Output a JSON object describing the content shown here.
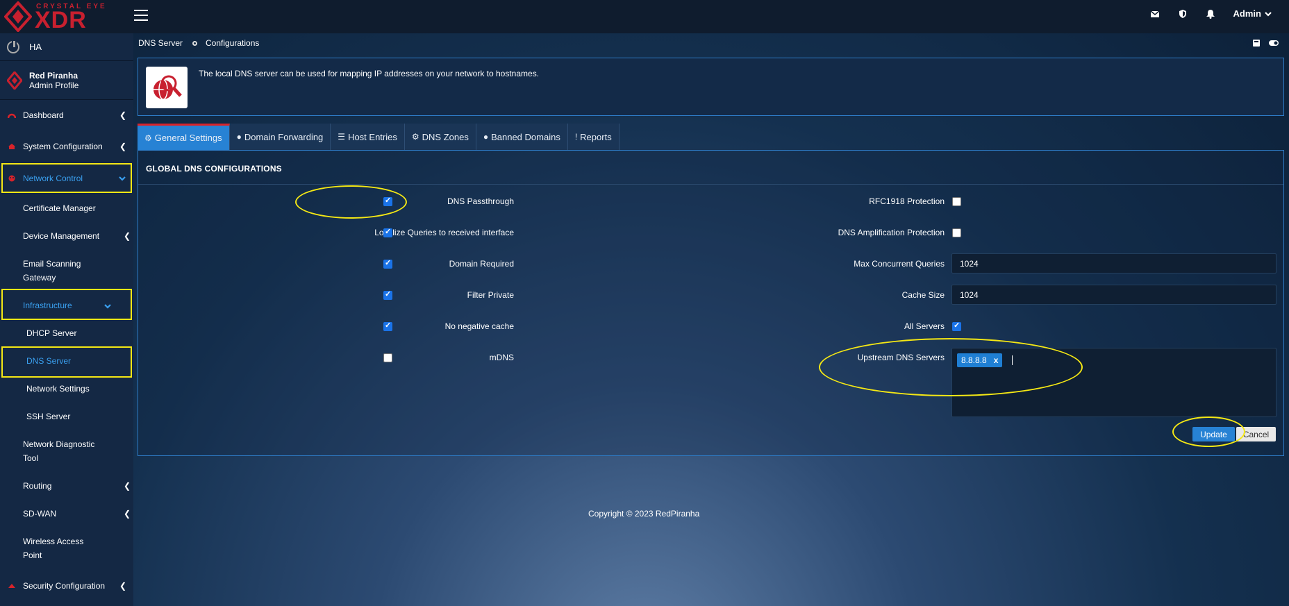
{
  "topbar": {
    "brand_small": "CRYSTAL EYE",
    "brand_big": "XDR",
    "admin_label": "Admin"
  },
  "sidebar": {
    "ha_label": "HA",
    "profile_name": "Red Piranha",
    "profile_role": "Admin Profile",
    "items": [
      {
        "label": "Dashboard"
      },
      {
        "label": "System Configuration"
      },
      {
        "label": "Network Control"
      },
      {
        "label": "Certificate Manager"
      },
      {
        "label": "Device Management"
      },
      {
        "label": "Email Scanning",
        "label2": "Gateway"
      },
      {
        "label": "Infrastructure"
      },
      {
        "label": "DHCP Server"
      },
      {
        "label": "DNS Server"
      },
      {
        "label": "Network Settings"
      },
      {
        "label": "SSH Server"
      },
      {
        "label": "Network Diagnostic",
        "label2": "Tool"
      },
      {
        "label": "Routing"
      },
      {
        "label": "SD-WAN"
      },
      {
        "label": "Wireless Access",
        "label2": "Point"
      },
      {
        "label": "Security Configuration"
      }
    ]
  },
  "breadcrumb": {
    "first": "DNS Server",
    "second": "Configurations"
  },
  "info": {
    "message": "The local DNS server can be used for mapping IP addresses on your network to hostnames."
  },
  "tabs": [
    {
      "label": "General Settings"
    },
    {
      "label": "Domain Forwarding"
    },
    {
      "label": "Host Entries"
    },
    {
      "label": "DNS Zones"
    },
    {
      "label": "Banned Domains"
    },
    {
      "label": "Reports"
    }
  ],
  "panel": {
    "title": "GLOBAL DNS CONFIGURATIONS",
    "left_fields": [
      {
        "label": "DNS Passthrough",
        "checked": true
      },
      {
        "label": "Localize Queries to received interface",
        "checked": true
      },
      {
        "label": "Domain Required",
        "checked": true
      },
      {
        "label": "Filter Private",
        "checked": true
      },
      {
        "label": "No negative cache",
        "checked": true
      },
      {
        "label": "mDNS",
        "checked": false
      }
    ],
    "right_fields": {
      "rfc1918_label": "RFC1918 Protection",
      "rfc1918_checked": false,
      "amplification_label": "DNS Amplification Protection",
      "amplification_checked": false,
      "max_queries_label": "Max Concurrent Queries",
      "max_queries_value": "1024",
      "cache_size_label": "Cache Size",
      "cache_size_value": "1024",
      "all_servers_label": "All Servers",
      "all_servers_checked": true,
      "upstream_label": "Upstream DNS Servers",
      "upstream_tags": [
        "8.8.8.8"
      ],
      "tag_remove": "x"
    },
    "update_label": "Update",
    "cancel_label": "Cancel"
  },
  "footer": {
    "copyright": "Copyright © 2023 RedPiranha"
  },
  "colors": {
    "accent": "#2782d4",
    "brand": "#c8202f",
    "highlight": "#f5e814"
  }
}
